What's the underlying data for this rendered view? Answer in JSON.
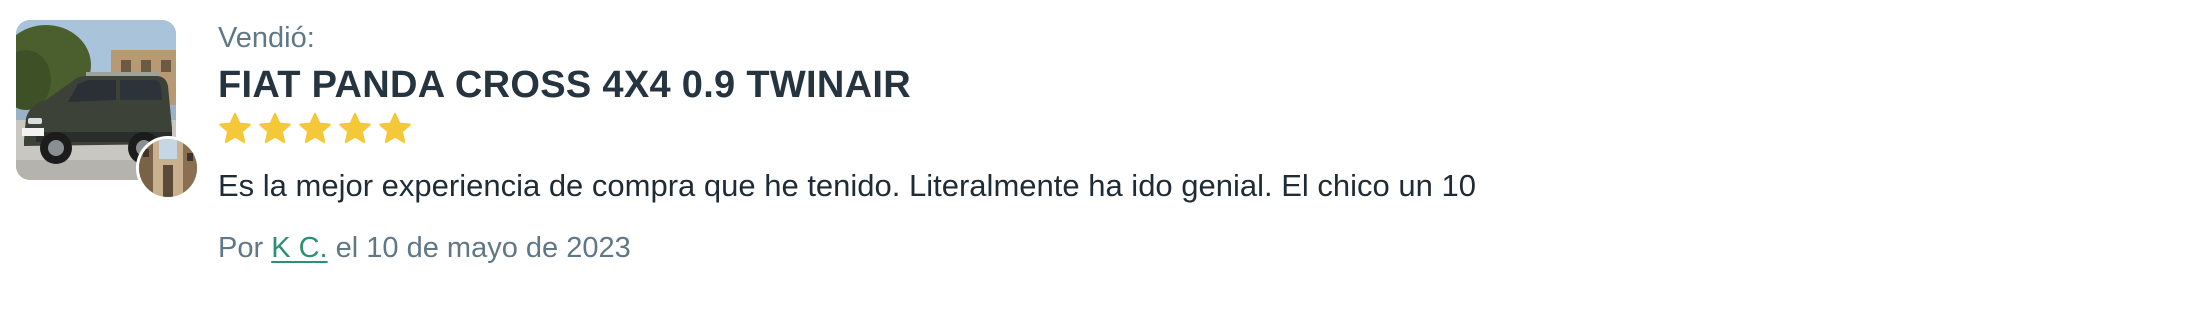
{
  "review": {
    "sold_label": "Vendió:",
    "car_title": "FIAT PANDA CROSS 4X4 0.9 TWINAIR",
    "rating": 5,
    "rating_max": 5,
    "star_color": "#f5c83a",
    "comment": "Es la mejor experiencia de compra que he tenido. Literalmente ha ido genial. El chico un 10",
    "byline": {
      "prefix": "Por",
      "author": "K C.",
      "date_text": "el 10 de mayo de 2023"
    },
    "colors": {
      "title": "#263440",
      "muted": "#5f7787",
      "link": "#2f8f72",
      "body_text": "#1f2b35"
    }
  }
}
